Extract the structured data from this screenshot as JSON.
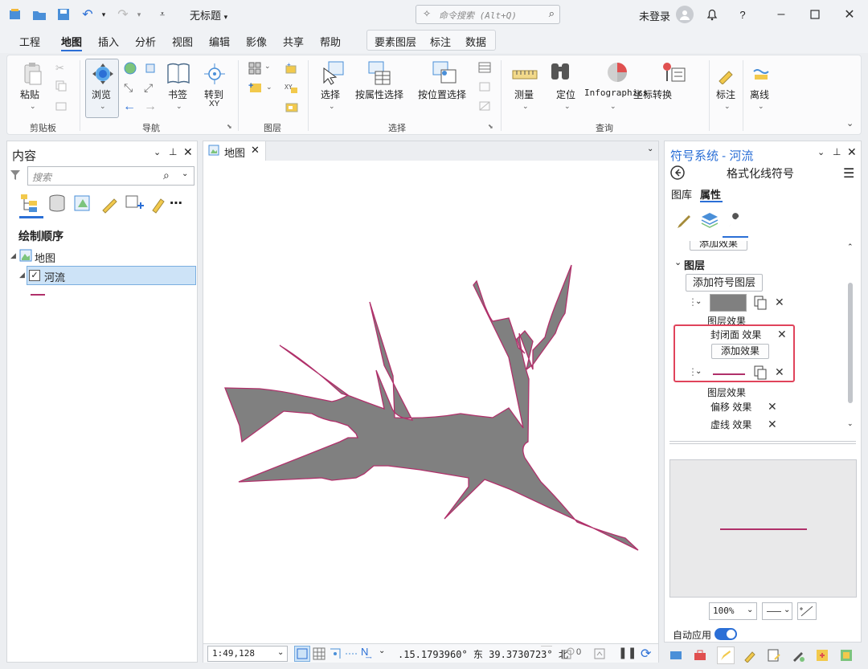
{
  "window": {
    "title": "无标题",
    "search_placeholder": "命令搜索 (Alt+Q)",
    "login": "未登录"
  },
  "menu": {
    "tabs": [
      "工程",
      "地图",
      "插入",
      "分析",
      "视图",
      "编辑",
      "影像",
      "共享",
      "帮助"
    ],
    "active": "地图",
    "context_tabs": [
      "要素图层",
      "标注",
      "数据"
    ]
  },
  "ribbon": {
    "paste": "粘贴",
    "browse": "浏览",
    "bookmark": "书签",
    "goto": "转到",
    "goto_sub": "XY",
    "select": "选择",
    "select_by_attr": "按属性选择",
    "select_by_loc": "按位置选择",
    "measure": "测量",
    "locate": "定位",
    "infographics": "Infographics",
    "coord_convert": "坐标转换",
    "label": "标注",
    "offline": "离线",
    "groups": {
      "clipboard": "剪贴板",
      "navigate": "导航",
      "layer": "图层",
      "selection": "选择",
      "inquiry": "查询"
    }
  },
  "contents": {
    "title": "内容",
    "search_placeholder": "搜索",
    "drawing_order": "绘制顺序",
    "map_item": "地图",
    "layer_item": "河流"
  },
  "map": {
    "tab": "地图",
    "scale": "1:49,128",
    "coords": ".15.1793960° 东  39.3730723° 北",
    "selected_count": "0"
  },
  "symbology": {
    "title": "符号系统 - 河流",
    "subtitle": "格式化线符号",
    "tab_gallery": "图库",
    "tab_properties": "属性",
    "add_effect_top": "添加效果",
    "layers_heading": "图层",
    "add_symbol_layer": "添加符号图层",
    "layer_effects_1": "图层效果",
    "closed_surface_effect": "封闭面 效果",
    "add_effect": "添加效果",
    "layer_effects_2": "图层效果",
    "offset_effect": "偏移 效果",
    "dash_effect": "虚线 效果",
    "zoom": "100%",
    "auto_apply": "自动应用"
  },
  "colors": {
    "accent": "#2b6fd6",
    "river_fill": "#808080",
    "river_stroke": "#b0306a",
    "highlight_box": "#e0435b"
  }
}
